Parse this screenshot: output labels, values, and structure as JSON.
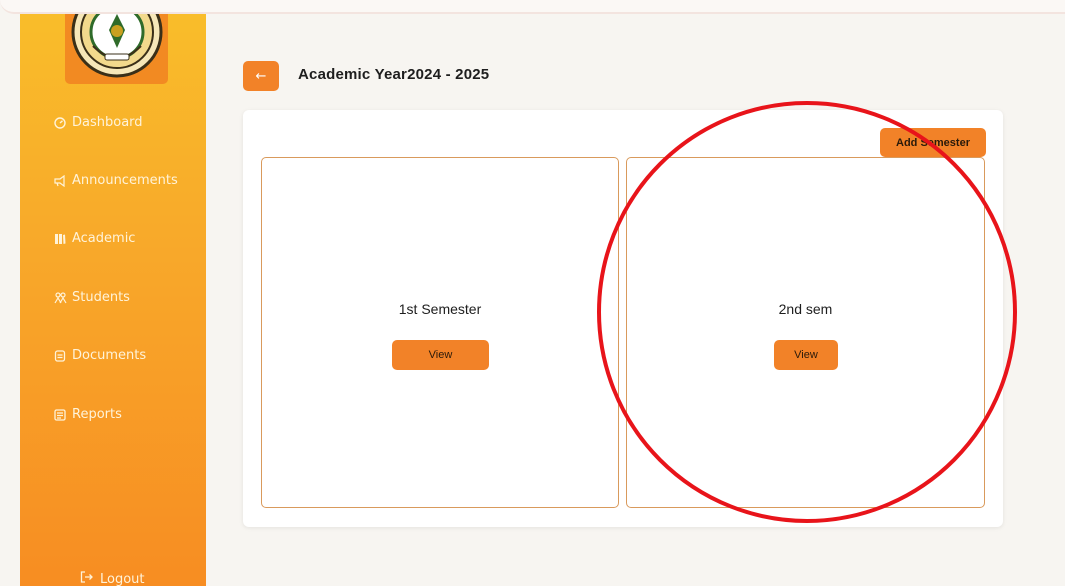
{
  "sidebar": {
    "items": [
      {
        "label": "Dashboard",
        "icon": "gauge-icon"
      },
      {
        "label": "Announcements",
        "icon": "megaphone-icon"
      },
      {
        "label": "Academic",
        "icon": "books-icon"
      },
      {
        "label": "Students",
        "icon": "students-icon"
      },
      {
        "label": "Documents",
        "icon": "document-icon"
      },
      {
        "label": "Reports",
        "icon": "report-icon"
      }
    ],
    "logout_label": "Logout"
  },
  "header": {
    "back_glyph": "←",
    "title": "Academic Year2024 - 2025"
  },
  "panel": {
    "add_label": "Add Semester",
    "cards": [
      {
        "title": "1st Semester",
        "view_label": "View"
      },
      {
        "title": "2nd sem",
        "view_label": "View"
      }
    ]
  },
  "colors": {
    "accent": "#f28228",
    "sidebar_top": "#f9bd2a",
    "sidebar_bottom": "#f78d22",
    "annotation": "#e8141a"
  }
}
